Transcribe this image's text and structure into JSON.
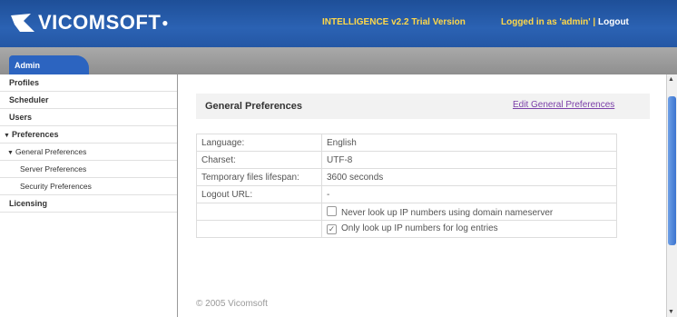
{
  "header": {
    "logo": "VICOMSOFT",
    "version": "INTELLIGENCE v2.2 Trial Version",
    "login_text": "Logged in as 'admin' |",
    "logout": "Logout"
  },
  "tabs": [
    {
      "label": "Admin"
    }
  ],
  "sidebar": {
    "items": [
      {
        "label": "Profiles"
      },
      {
        "label": "Scheduler"
      },
      {
        "label": "Users"
      },
      {
        "label": "Preferences"
      },
      {
        "label": "General Preferences"
      },
      {
        "label": "Server Preferences"
      },
      {
        "label": "Security Preferences"
      },
      {
        "label": "Licensing"
      }
    ]
  },
  "main": {
    "title": "General Preferences",
    "edit_link": "Edit General Preferences",
    "rows": [
      {
        "key": "Language:",
        "value": "English"
      },
      {
        "key": "Charset:",
        "value": "UTF-8"
      },
      {
        "key": "Temporary files lifespan:",
        "value": "3600 seconds"
      },
      {
        "key": "Logout URL:",
        "value": "-"
      }
    ],
    "options": [
      {
        "label": "Never look up IP numbers using domain nameserver",
        "checked": false
      },
      {
        "label": "Only look up IP numbers for log entries",
        "checked": true
      }
    ],
    "footer": "© 2005 Vicomsoft"
  }
}
